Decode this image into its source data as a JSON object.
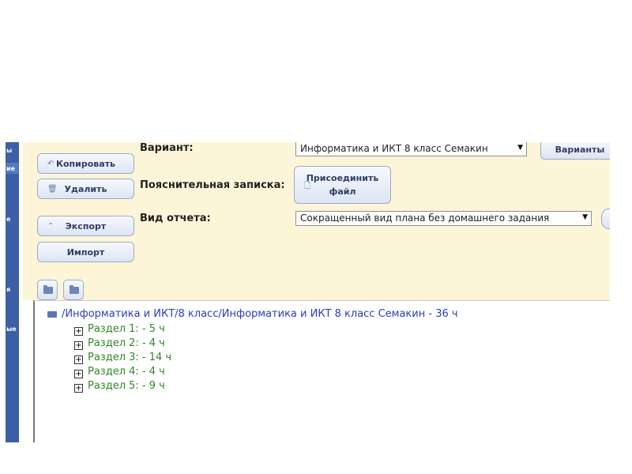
{
  "sidebar": {
    "fragments": [
      "ы",
      "ие",
      "е",
      "я",
      "ые"
    ]
  },
  "toolbar": {
    "copy_label": "Копировать",
    "delete_label": "Удалить",
    "export_label": "Экспорт",
    "import_label": "Импорт",
    "copy_icon": "undo-arrow-icon",
    "delete_icon": "trash-icon",
    "export_icon": "chevron-up-icon"
  },
  "form": {
    "variant_label": "Вариант:",
    "variant_value": "Информатика и ИКТ 8 класс Семакин",
    "variants_button": "Варианты",
    "note_label": "Пояснительная записка:",
    "attach_line1": "Присоединить",
    "attach_line2": "файл",
    "report_label": "Вид отчета:",
    "report_value": "Сокращенный вид плана без домашнего задания"
  },
  "tree": {
    "root": "/Информатика и ИКТ/8 класс/Информатика и ИКТ 8 класс Семакин - 36 ч",
    "nodes": [
      "Раздел 1: - 5 ч",
      "Раздел 2: - 4 ч",
      "Раздел 3: - 14 ч",
      "Раздел 4: - 4 ч",
      "Раздел 5: - 9 ч"
    ]
  },
  "colors": {
    "panel": "#fdf5d7",
    "sidebar": "#3d5fa8",
    "root_text": "#2a3fbd",
    "node_text": "#2d8a23"
  }
}
